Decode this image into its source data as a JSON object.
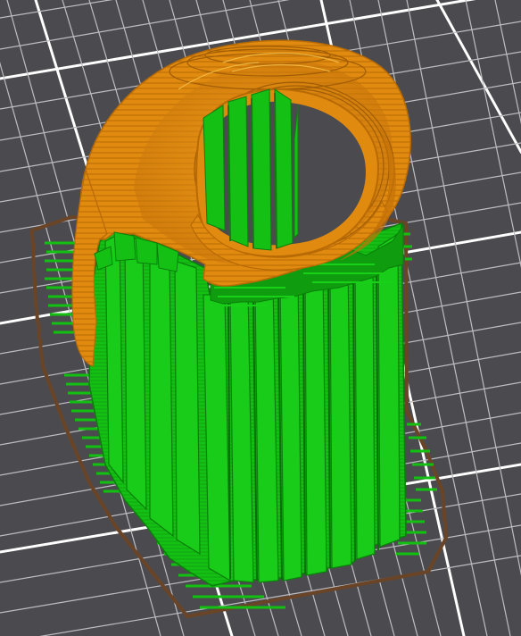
{
  "view": {
    "label": "",
    "colors": {
      "bed": "#4b4b4f",
      "grid_major": "#ffffff",
      "grid_minor": "#c9c9cc",
      "skirt": "#6a4426",
      "support": "#12c012",
      "support_edge": "#0a7f0a",
      "model": "#e08a10",
      "model_edge": "#b86a05"
    },
    "features": [
      {
        "name": "build-plate-grid",
        "color": "grid"
      },
      {
        "name": "skirt",
        "color": "brown"
      },
      {
        "name": "support",
        "color": "green"
      },
      {
        "name": "model",
        "color": "orange"
      }
    ]
  }
}
